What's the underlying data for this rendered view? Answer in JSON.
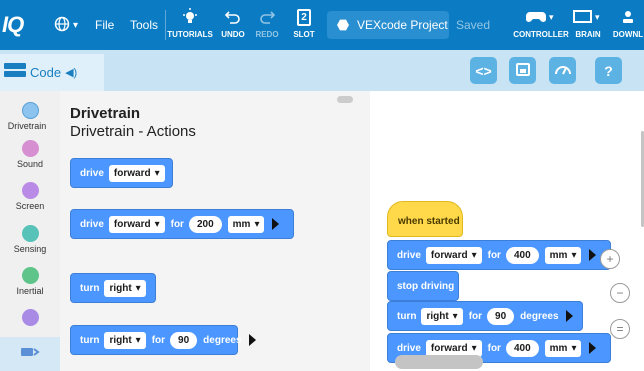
{
  "toolbar": {
    "logo": "IQ",
    "file": "File",
    "tools": "Tools",
    "tutorials": "TUTORIALS",
    "undo": "UNDO",
    "redo": "REDO",
    "slot": "SLOT",
    "slot_number": "2",
    "project_name": "VEXcode Project",
    "saved_status": "Saved",
    "controller": "CONTROLLER",
    "brain": "BRAIN",
    "download": "DOWNL"
  },
  "subbar": {
    "code_tab": "Code",
    "code_view_icon": "<>"
  },
  "categories": [
    {
      "label": "Drivetrain",
      "color": "#8cc4ef"
    },
    {
      "label": "Sound",
      "color": "#d68fd0"
    },
    {
      "label": "Screen",
      "color": "#b98ae6"
    },
    {
      "label": "Sensing",
      "color": "#56c2b8"
    },
    {
      "label": "Inertial",
      "color": "#5fc48a"
    },
    {
      "label": "",
      "color": "#a98be6"
    }
  ],
  "palette": {
    "title": "Drivetrain",
    "subtitle": "Drivetrain - Actions",
    "blocks": {
      "drive1": {
        "t1": "drive",
        "dir": "forward"
      },
      "drive2": {
        "t1": "drive",
        "dir": "forward",
        "t2": "for",
        "val": "200",
        "unit": "mm"
      },
      "turn1": {
        "t1": "turn",
        "dir": "right"
      },
      "turn2": {
        "t1": "turn",
        "dir": "right",
        "t2": "for",
        "val": "90",
        "unit": "degrees"
      }
    }
  },
  "workspace": {
    "hat": "when started",
    "b1": {
      "t1": "drive",
      "dir": "forward",
      "t2": "for",
      "val": "400",
      "unit": "mm"
    },
    "b2": {
      "t1": "stop driving"
    },
    "b3": {
      "t1": "turn",
      "dir": "right",
      "t2": "for",
      "val": "90",
      "unit": "degrees"
    },
    "b4": {
      "t1": "drive",
      "dir": "forward",
      "t2": "for",
      "val": "400",
      "unit": "mm"
    }
  },
  "zoom": {
    "in": "+",
    "out": "−",
    "reset": "="
  },
  "colors": {
    "topbar": "#0b7cc3",
    "block": "#4c97ff",
    "hat": "#ffd94a"
  }
}
